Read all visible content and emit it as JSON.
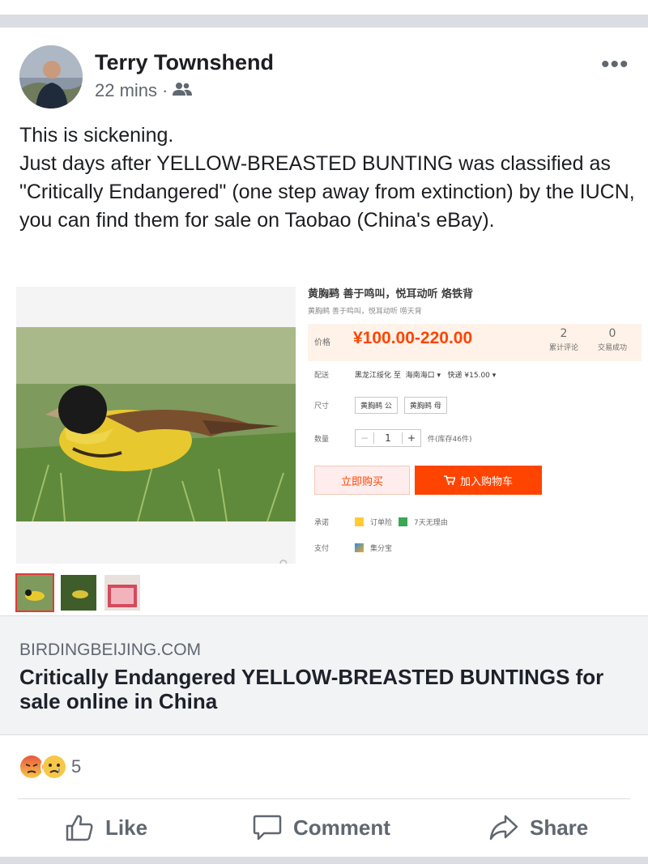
{
  "post": {
    "author": "Terry Townshend",
    "time": "22 mins",
    "separator": "·",
    "audience_icon": "friends-icon",
    "more_icon": "more-options-icon",
    "more_label": "•••",
    "text": "This is sickening.\n Just days after YELLOW-BREASTED BUNTING was classified as \"Critically Endangered\" (one step away from extinction) by the IUCN, you can find them for sale on Taobao (China's eBay)."
  },
  "shop": {
    "title": "黄胸鹀 善于鸣叫，悦耳动听 烙铁背",
    "subtitle": "黄胸鹀 善于鸣叫，悦耳动听 唠天背",
    "price_label": "价格",
    "price": "¥100.00-220.00",
    "reviews_count": "2",
    "reviews_label": "累计评论",
    "sales_count": "0",
    "sales_label": "交易成功",
    "shipping_label": "配送",
    "shipping_value": "黑龙江绥化 至  海南海口 ▾   快递 ¥15.00 ▾",
    "size_label": "尺寸",
    "size_options": [
      "黄胸鹀 公",
      "黄胸鹀 母"
    ],
    "qty_label": "数量",
    "qty_minus": "−",
    "qty_value": "1",
    "qty_plus": "+",
    "stock_text": "件(库存46件)",
    "buy_now": "立即购买",
    "add_to_cart": "加入购物车",
    "cart_icon": "cart-icon",
    "promise_label": "承诺",
    "promise_1": "订单险",
    "promise_2": "7天无理由",
    "pay_label": "支付",
    "pay_value": "集分宝"
  },
  "link": {
    "domain": "BIRDINGBEIJING.COM",
    "title": "Critically Endangered YELLOW-BREASTED BUNTINGS for sale online in China"
  },
  "reactions": {
    "types": [
      "angry",
      "sad"
    ],
    "count": "5"
  },
  "actions": {
    "like": "Like",
    "comment": "Comment",
    "share": "Share"
  }
}
